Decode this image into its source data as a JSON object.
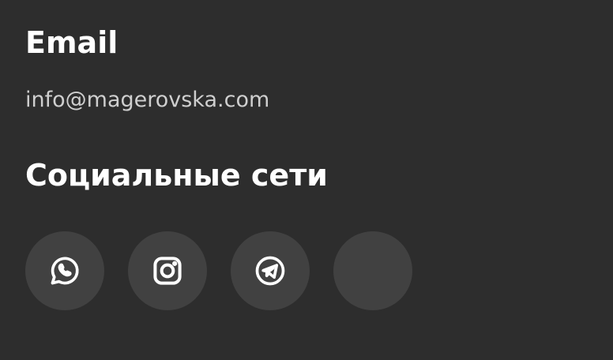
{
  "email": {
    "heading": "Email",
    "address": "info@magerovska.com"
  },
  "social": {
    "heading": "Социальные сети",
    "links": [
      {
        "icon": "whatsapp-icon"
      },
      {
        "icon": "instagram-icon"
      },
      {
        "icon": "telegram-icon"
      },
      {
        "icon": ""
      }
    ]
  },
  "colors": {
    "background": "#2d2d2d",
    "button_bg": "#414141",
    "heading": "#ffffff",
    "link": "#cfcfcf"
  }
}
